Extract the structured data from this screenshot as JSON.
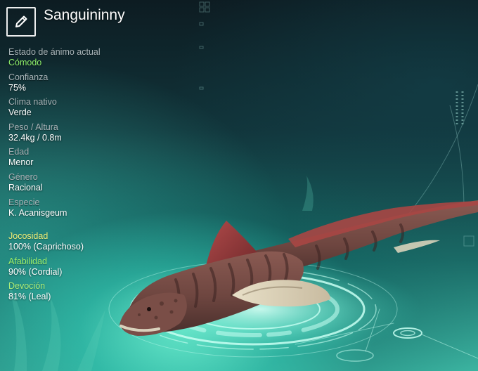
{
  "creature": {
    "name": "Sanguininny"
  },
  "stats": {
    "mood_label": "Estado de ánimo actual",
    "mood_value": "Cómodo",
    "confidence_label": "Confianza",
    "confidence_value": "75%",
    "climate_label": "Clima nativo",
    "climate_value": "Verde",
    "weight_height_label": "Peso / Altura",
    "weight_height_value": "32.4kg / 0.8m",
    "age_label": "Edad",
    "age_value": "Menor",
    "gender_label": "Género",
    "gender_value": "Racional",
    "species_label": "Especie",
    "species_value": "K. Acanisgeum"
  },
  "traits": {
    "playfulness_label": "Jocosidad",
    "playfulness_value": "100% (Caprichoso)",
    "kindness_label": "Afabilidad",
    "kindness_value": "90% (Cordial)",
    "devotion_label": "Devoción",
    "devotion_value": "81% (Leal)"
  },
  "icons": {
    "edit": "pencil-icon"
  },
  "colors": {
    "mood_value": "#8ff06a",
    "playfulness_label": "#f2f27a",
    "kindness_label": "#9ef06a",
    "devotion_label": "#aef07a",
    "hologram": "#c8fff2"
  }
}
